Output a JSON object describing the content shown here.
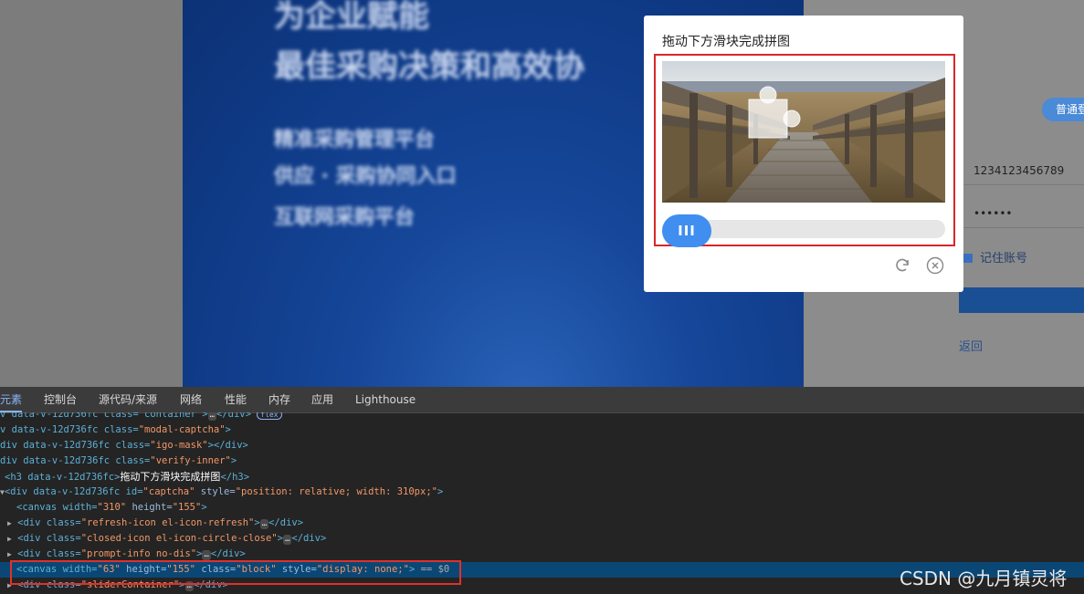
{
  "page": {
    "banner_lines": [
      "为企业赋能",
      "最佳采购决策和高效协",
      "精准采购管理平台",
      "供应 · 采购协同入口",
      "互联网采购平台"
    ],
    "login_type_pill": "普通登",
    "account_value": "1234123456789",
    "password_value": "••••••",
    "remember_label": "记住账号",
    "back_link": "返回"
  },
  "captcha": {
    "title": "拖动下方滑块完成拼图",
    "slider_handle_glyph": "III",
    "refresh_icon": "refresh-icon",
    "close_icon": "close-circle-icon",
    "accent_color": "#3f8ef0",
    "highlight_color": "#d9262a"
  },
  "devtools": {
    "tabs": [
      "元素",
      "控制台",
      "源代码/来源",
      "网络",
      "性能",
      "内存",
      "应用",
      "Lighthouse"
    ],
    "active_tab": "元素",
    "lines": {
      "l0": {
        "a": "v data-v-12d736fc class=\"container\">",
        "b": "…",
        "c": "</div>",
        "badge": "flex"
      },
      "l1": {
        "a": "v data-v-12d736fc class=",
        "v": "\"modal-captcha\"",
        "e": ">"
      },
      "l2": {
        "a": "div data-v-12d736fc class=",
        "v": "\"igo-mask\"",
        "e": "></div>"
      },
      "l3": {
        "a": "div data-v-12d736fc class=",
        "v": "\"verify-inner\"",
        "e": ">"
      },
      "l4": {
        "a": "<h3 data-v-12d736fc>",
        "t": "拖动下方滑块完成拼图",
        "e": "</h3>"
      },
      "l5": {
        "a": "<div data-v-12d736fc id=",
        "v1": "\"captcha\"",
        "m": " style=",
        "v2": "\"position: relative; width: 310px;\"",
        "e": ">"
      },
      "l6": {
        "a": "<canvas width=",
        "v1": "\"310\"",
        "m": " height=",
        "v2": "\"155\"",
        "e": ">"
      },
      "l7": {
        "a": "<div class=",
        "v": "\"refresh-icon el-icon-refresh\"",
        "e": ">",
        "d": "…",
        "c": "</div>"
      },
      "l8": {
        "a": "<div class=",
        "v": "\"closed-icon el-icon-circle-close\"",
        "e": ">",
        "d": "…",
        "c": "</div>"
      },
      "l9": {
        "a": "<div class=",
        "v": "\"prompt-info no-dis\"",
        "e": ">",
        "d": "…",
        "c": "</div>"
      },
      "l10": {
        "a": "<canvas width=",
        "v1": "\"63\"",
        "m1": " height=",
        "v2": "\"155\"",
        "m2": " class=",
        "v3": "\"block\"",
        "m3": " style=",
        "v4": "\"display: none;\"",
        "e": ">",
        "eq": " == $0"
      },
      "l11": {
        "a": "<div class=",
        "v": "\"sliderContainer\"",
        "e": ">",
        "d": "…",
        "c": "</div>"
      }
    }
  },
  "watermark": "CSDN @九月镇灵将"
}
